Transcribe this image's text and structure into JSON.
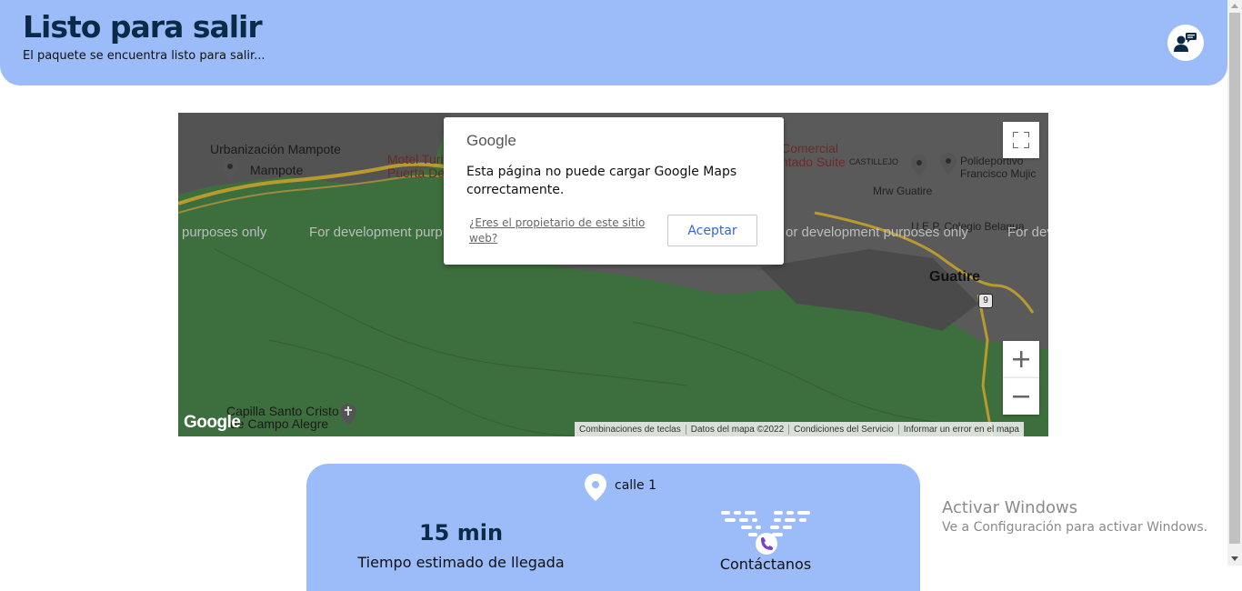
{
  "header": {
    "title": "Listo para salir",
    "subtitle": "El paquete se encuentra listo para salir...",
    "chat_icon": "support-chat-icon"
  },
  "map": {
    "places": {
      "urbanizacion": "Urbanización Mampote",
      "mampote": "Mampote",
      "motel": "Motel Turi",
      "puerta": "Puerta De",
      "comercial": "Comercial",
      "santo_suite": "ntado Suite",
      "castillejo": "CASTILLEJO",
      "polideportivo": "Polideportivo",
      "francisco": "Francisco Mujic",
      "mrw": "Mrw Guatire",
      "colegio": "U.E.P. Colegio Belagua",
      "guatire": "Guatire",
      "capilla": "Capilla Santo Cristo",
      "campo_alegre": "de Campo Alegre",
      "route": "9"
    },
    "dev_watermark": {
      "left": "purposes only",
      "mid": "For development purp",
      "right": "or development purposes only",
      "far_right": "For dev"
    },
    "google_logo": "Google",
    "attribution": {
      "shortcuts": "Combinaciones de teclas",
      "data": "Datos del mapa ©2022",
      "terms": "Condiciones del Servicio",
      "report": "Informar un error en el mapa"
    },
    "dialog": {
      "logo": "Google",
      "message": "Esta página no puede cargar Google Maps correctamente.",
      "owner_link": "¿Eres el propietario de este sitio web?",
      "accept": "Aceptar"
    }
  },
  "card": {
    "address": "calle 1",
    "eta_value": "15 min",
    "eta_label": "Tiempo estimado de llegada",
    "contact_label": "Contáctanos"
  },
  "windows_watermark": {
    "title": "Activar Windows",
    "subtitle": "Ve a Configuración para activar Windows."
  },
  "colors": {
    "header_bg": "#9bbcf9",
    "title": "#0b2a47",
    "map_green": "#3f6f3f",
    "accept_link": "#3367d6"
  }
}
